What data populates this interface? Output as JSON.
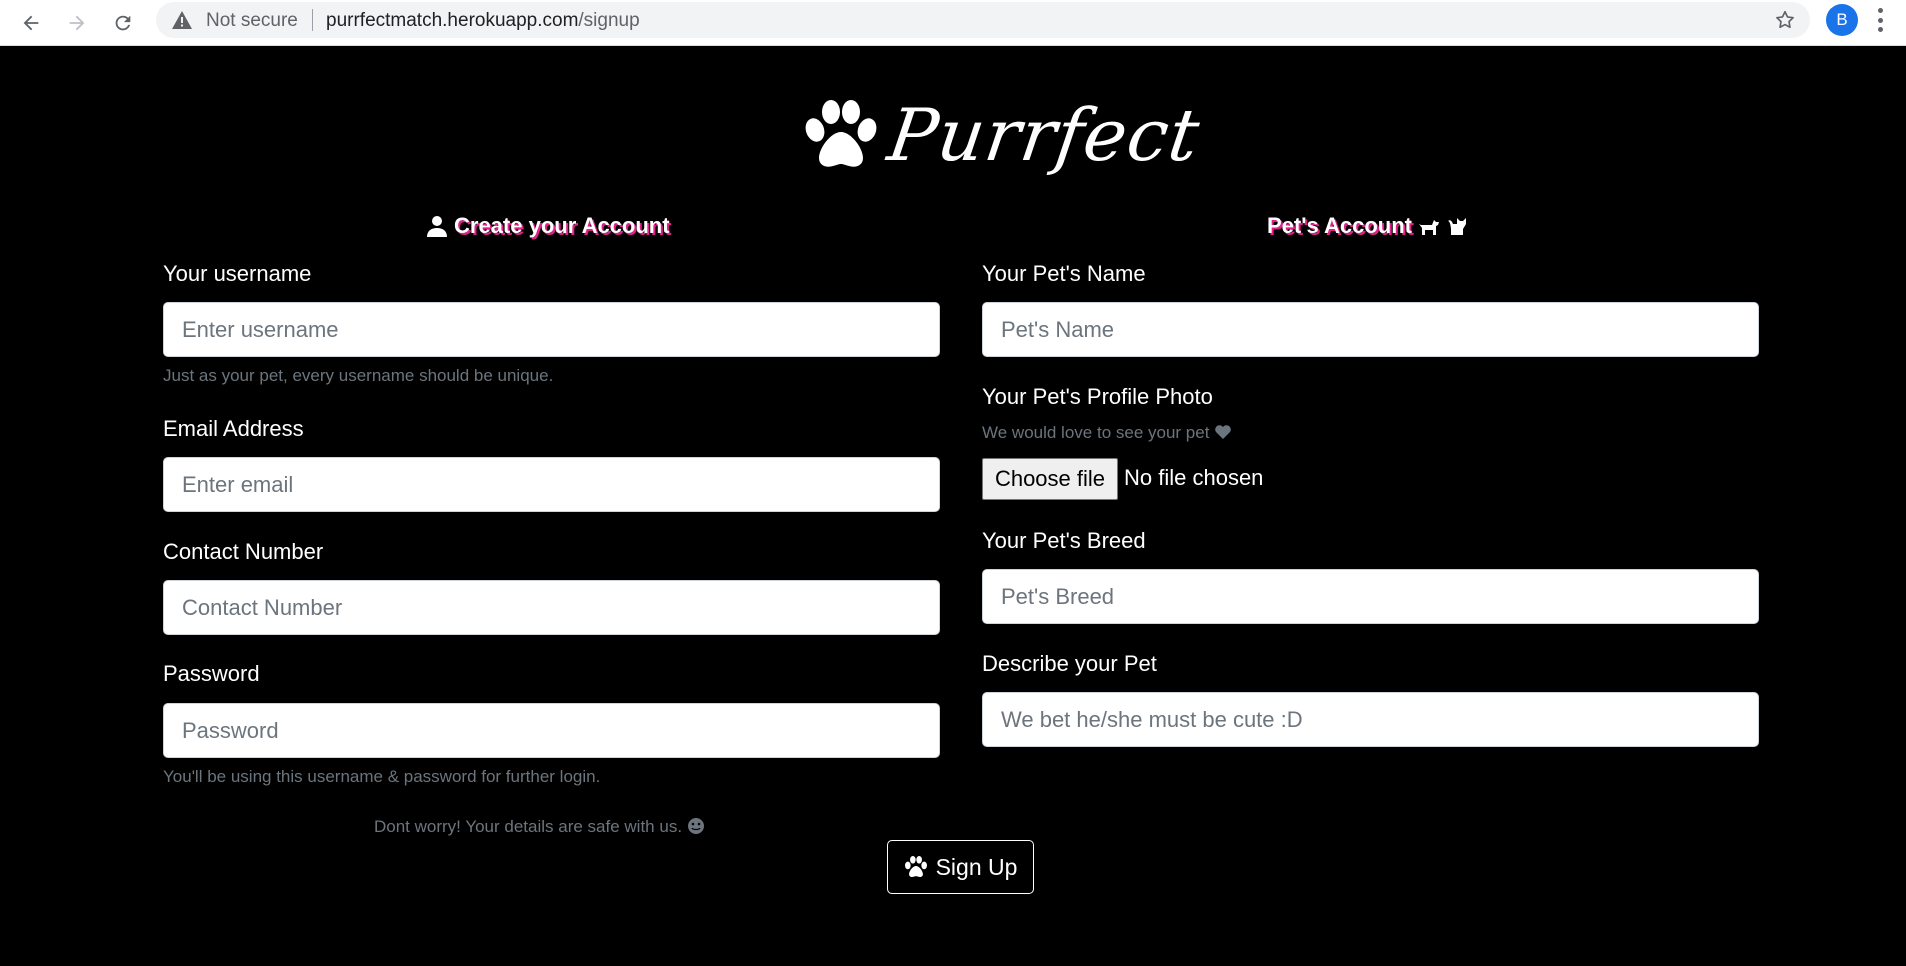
{
  "browser": {
    "security_label": "Not secure",
    "url_host": "purrfectmatch.herokuapp.com",
    "url_path": "/signup",
    "profile_initial": "B"
  },
  "logo": {
    "text": "Purrfect",
    "icon": "paw-icon"
  },
  "account": {
    "heading": "Create your Account",
    "heading_icon": "user-icon",
    "username": {
      "label": "Your username",
      "placeholder": "Enter username",
      "help": "Just as your pet, every username should be unique."
    },
    "email": {
      "label": "Email Address",
      "placeholder": "Enter email"
    },
    "contact": {
      "label": "Contact Number",
      "placeholder": "Contact Number"
    },
    "password": {
      "label": "Password",
      "placeholder": "Password",
      "help": "You'll be using this username & password for further login."
    },
    "safe_note": "Dont worry! Your details are safe with us."
  },
  "pet": {
    "heading": "Pet's Account",
    "heading_icons": [
      "dog-icon",
      "cat-icon"
    ],
    "name": {
      "label": "Your Pet's Name",
      "placeholder": "Pet's Name"
    },
    "photo": {
      "label": "Your Pet's Profile Photo",
      "help": "We would love to see your pet",
      "button": "Choose file",
      "status": "No file chosen"
    },
    "breed": {
      "label": "Your Pet's Breed",
      "placeholder": "Pet's Breed"
    },
    "describe": {
      "label": "Describe your Pet",
      "placeholder": "We bet he/she must be cute :D"
    }
  },
  "signup_button": {
    "label": "Sign Up"
  },
  "colors": {
    "background": "#000000",
    "heading_shadow": "#e0218a",
    "help_text": "#6c757d"
  }
}
